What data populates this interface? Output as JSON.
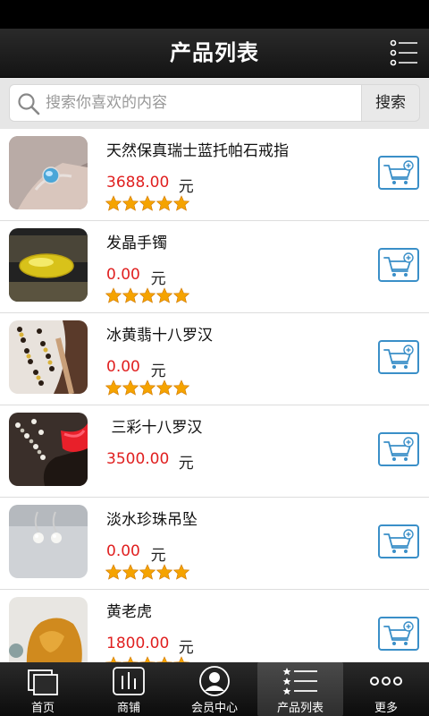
{
  "header": {
    "title": "产品列表",
    "menu_icon": "list-menu-icon"
  },
  "search": {
    "placeholder": "搜索你喜欢的内容",
    "button_label": "搜索"
  },
  "colors": {
    "price": "#e02020",
    "accent": "#3a8fc8",
    "star": "#f5a300"
  },
  "products": [
    {
      "name": "天然保真瑞士蓝托帕石戒指",
      "price": "3688.00",
      "unit": "元",
      "stars": 5,
      "thumb": "ring"
    },
    {
      "name": "发晶手镯",
      "price": "0.00",
      "unit": "元",
      "stars": 5,
      "thumb": "bangle"
    },
    {
      "name": "冰黄翡十八罗汉",
      "price": "0.00",
      "unit": "元",
      "stars": 5,
      "thumb": "beads"
    },
    {
      "name": " 三彩十八罗汉",
      "price": "3500.00",
      "unit": "元",
      "stars": 0,
      "thumb": "beads-red"
    },
    {
      "name": "淡水珍珠吊坠",
      "price": "0.00",
      "unit": "元",
      "stars": 5,
      "thumb": "pearls"
    },
    {
      "name": "黄老虎",
      "price": "1800.00",
      "unit": "元",
      "stars": 5,
      "thumb": "amber"
    }
  ],
  "tabs": [
    {
      "label": "首页",
      "icon": "home-icon"
    },
    {
      "label": "商铺",
      "icon": "store-icon"
    },
    {
      "label": "会员中心",
      "icon": "member-icon"
    },
    {
      "label": "产品列表",
      "icon": "product-list-icon",
      "active": true
    },
    {
      "label": "更多",
      "icon": "more-icon"
    }
  ]
}
